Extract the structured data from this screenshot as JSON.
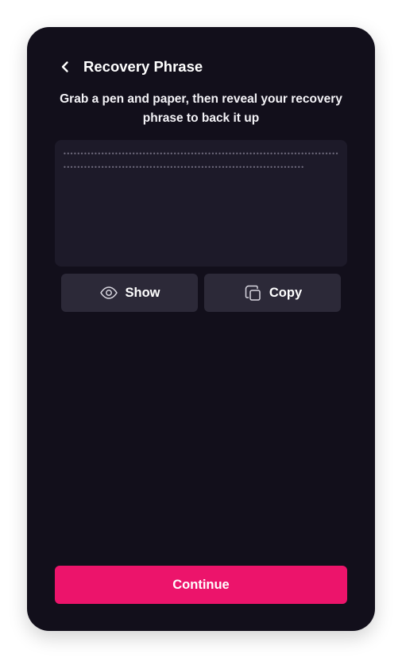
{
  "header": {
    "title": "Recovery Phrase",
    "back_icon": "chevron-left-icon"
  },
  "instructions": "Grab a pen and paper, then reveal your recovery phrase to back it up",
  "phrase": {
    "masked_text": "••••••••••••••••••••••••••••••••••••••••••••••••••••••••••••••••••••••••••••••••••••••••••••••••••••••••••••••••••••••••••••••••••••••••••••••••••••••",
    "revealed": false
  },
  "actions": {
    "show_label": "Show",
    "show_icon": "eye-icon",
    "copy_label": "Copy",
    "copy_icon": "copy-icon"
  },
  "footer": {
    "continue_label": "Continue"
  },
  "colors": {
    "background": "#120f1b",
    "panel": "#1d1a29",
    "button": "#2c2938",
    "accent": "#ec146b",
    "masked_dots": "#6e6a7c"
  }
}
